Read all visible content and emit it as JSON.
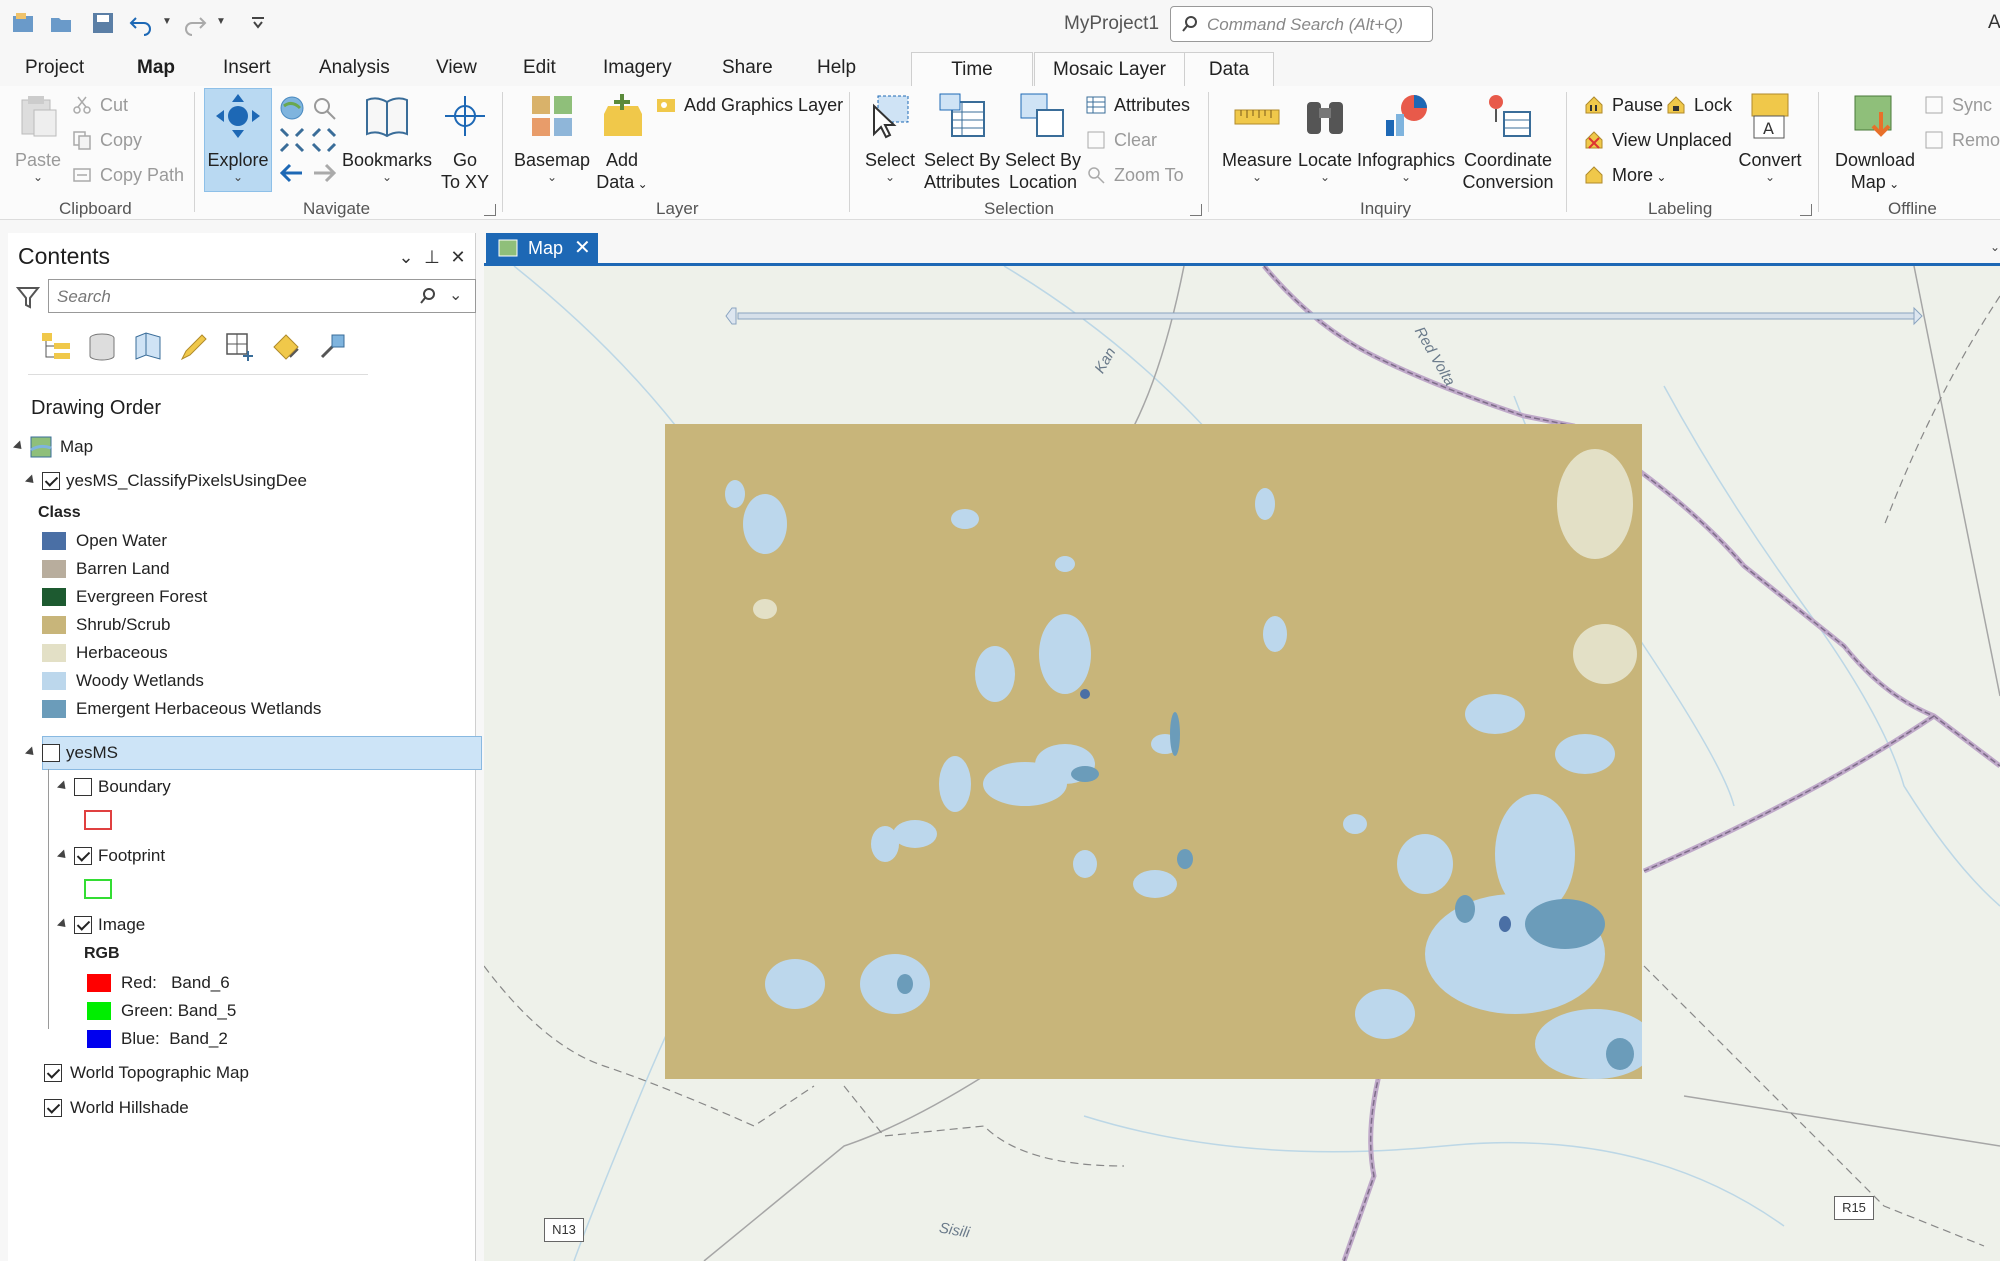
{
  "app": {
    "title": "MyProject1",
    "search_placeholder": "Command Search (Alt+Q)",
    "user_initial": "A"
  },
  "tabs": [
    {
      "label": "Project"
    },
    {
      "label": "Map",
      "active": true
    },
    {
      "label": "Insert"
    },
    {
      "label": "Analysis"
    },
    {
      "label": "View"
    },
    {
      "label": "Edit"
    },
    {
      "label": "Imagery"
    },
    {
      "label": "Share"
    },
    {
      "label": "Help"
    }
  ],
  "context_tabs": [
    {
      "label": "Time"
    },
    {
      "label": "Mosaic Layer"
    },
    {
      "label": "Data"
    }
  ],
  "ribbon": {
    "clipboard": {
      "paste": "Paste",
      "cut": "Cut",
      "copy": "Copy",
      "copy_path": "Copy Path",
      "group": "Clipboard"
    },
    "navigate": {
      "explore": "Explore",
      "bookmarks": "Bookmarks",
      "go_to_xy_1": "Go",
      "go_to_xy_2": "To XY",
      "group": "Navigate"
    },
    "layer": {
      "basemap": "Basemap",
      "add_data_1": "Add",
      "add_data_2": "Data",
      "add_graphics": "Add Graphics Layer",
      "group": "Layer"
    },
    "selection": {
      "select": "Select",
      "by_attr_1": "Select By",
      "by_attr_2": "Attributes",
      "by_loc_1": "Select By",
      "by_loc_2": "Location",
      "attributes": "Attributes",
      "clear": "Clear",
      "zoom_to": "Zoom To",
      "group": "Selection"
    },
    "inquiry": {
      "measure": "Measure",
      "locate": "Locate",
      "infographics": "Infographics",
      "coord_1": "Coordinate",
      "coord_2": "Conversion",
      "group": "Inquiry"
    },
    "labeling": {
      "pause": "Pause",
      "lock": "Lock",
      "view_unplaced": "View Unplaced",
      "more": "More",
      "convert": "Convert",
      "group": "Labeling"
    },
    "offline": {
      "download_1": "Download",
      "download_2": "Map",
      "sync": "Sync",
      "remove": "Remov",
      "group": "Offline"
    }
  },
  "contents": {
    "title": "Contents",
    "search_placeholder": "Search",
    "section": "Drawing Order",
    "map_label": "Map",
    "layer1": {
      "name": "yesMS_ClassifyPixelsUsingDee",
      "class_heading": "Class"
    },
    "classes": [
      {
        "label": "Open Water",
        "color": "#4a6fa5"
      },
      {
        "label": "Barren Land",
        "color": "#b8ad9d"
      },
      {
        "label": "Evergreen Forest",
        "color": "#1d5a30"
      },
      {
        "label": "Shrub/Scrub",
        "color": "#c8b57a"
      },
      {
        "label": "Herbaceous",
        "color": "#e3e0c6"
      },
      {
        "label": "Woody Wetlands",
        "color": "#bcd7ec"
      },
      {
        "label": "Emergent Herbaceous Wetlands",
        "color": "#6b9cba"
      }
    ],
    "layer2": {
      "name": "yesMS"
    },
    "boundary": "Boundary",
    "footprint": "Footprint",
    "image": "Image",
    "rgb_heading": "RGB",
    "bands": [
      {
        "label": "Red:   Band_6",
        "color": "#ff0000"
      },
      {
        "label": "Green: Band_5",
        "color": "#00ee00"
      },
      {
        "label": "Blue:  Band_2",
        "color": "#0000ee"
      }
    ],
    "basemap1": "World Topographic Map",
    "basemap2": "World Hillshade"
  },
  "map": {
    "tab_label": "Map",
    "labels": {
      "kan": "Kan",
      "red_volta": "Red Volta",
      "sisili": "Sisili",
      "n13": "N13",
      "r15": "R15"
    }
  }
}
